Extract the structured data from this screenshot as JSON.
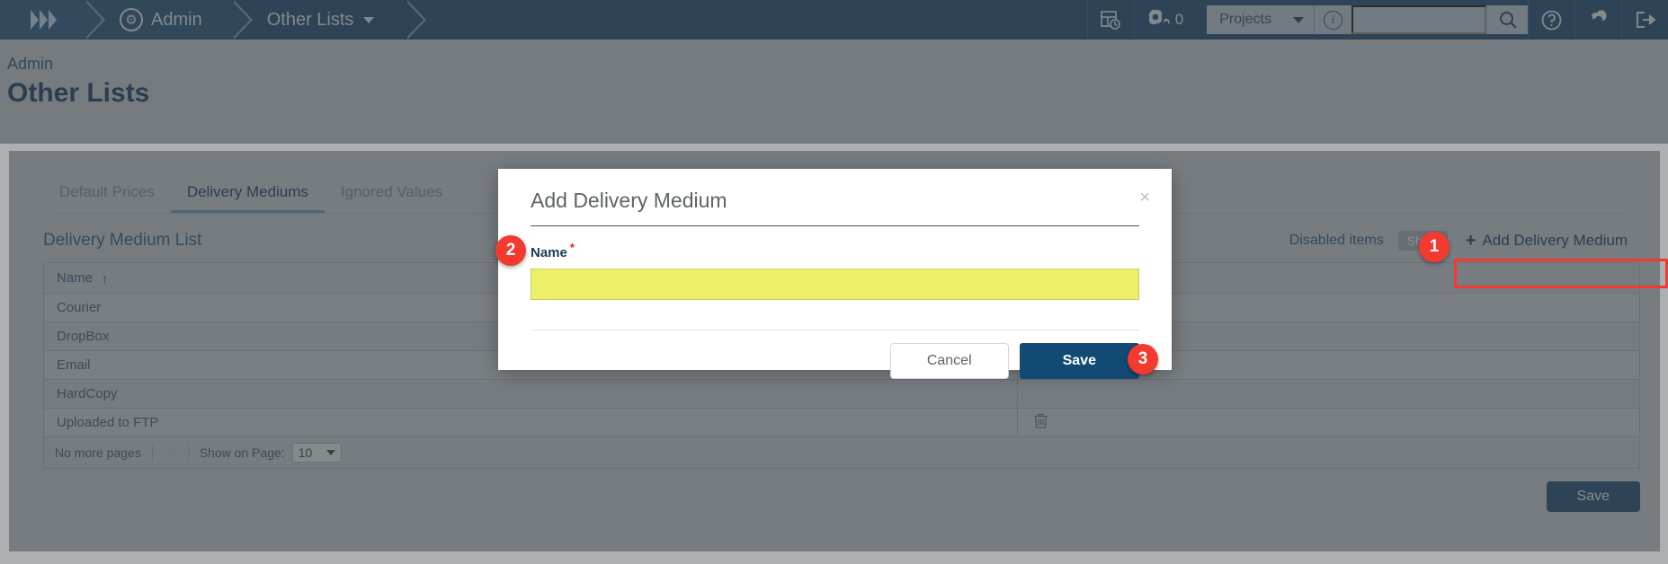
{
  "topbar": {
    "menu_icon": "hamburger-icon",
    "breadcrumbs": [
      {
        "label": "Admin",
        "icon": "gear-icon"
      },
      {
        "label": "Other Lists",
        "icon": "chevron-down-icon"
      }
    ],
    "dashboard_icon": "dashboard-clock-icon",
    "gears_icon": "gears-icon",
    "gears_count": "0",
    "project_select": "Projects",
    "info_icon": "info-icon",
    "search_placeholder": "",
    "search_icon": "search-icon",
    "help_icon": "help-icon",
    "settings_icon": "gear-icon",
    "logout_icon": "logout-icon"
  },
  "pagehead": {
    "parent": "Admin",
    "title": "Other Lists"
  },
  "tabs": [
    {
      "label": "Default Prices",
      "active": false
    },
    {
      "label": "Delivery Mediums",
      "active": true
    },
    {
      "label": "Ignored Values",
      "active": false
    }
  ],
  "list": {
    "title": "Delivery Medium List",
    "disabled_items_label": "Disabled items",
    "show_toggle": "Show",
    "add_button": "Add Delivery Medium",
    "add_plus": "+",
    "column_header": "Name",
    "sort_arrow": "↑",
    "rows": [
      {
        "name": "Courier",
        "action": ""
      },
      {
        "name": "DropBox",
        "action": ""
      },
      {
        "name": "Email",
        "action": ""
      },
      {
        "name": "HardCopy",
        "action": ""
      },
      {
        "name": "Uploaded to FTP",
        "action": "trash-icon"
      }
    ],
    "pager": {
      "status": "No more pages",
      "refresh_icon": "spinner-icon",
      "show_on_page_label": "Show on Page:",
      "page_size": "10"
    },
    "save_button": "Save"
  },
  "modal": {
    "title": "Add Delivery Medium",
    "close_icon": "×",
    "field_label": "Name",
    "required_mark": "*",
    "field_value": "",
    "field_placeholder": "",
    "cancel_button": "Cancel",
    "save_button": "Save"
  },
  "annotations": {
    "markers": [
      {
        "id": "1",
        "target": "add-delivery-medium-button"
      },
      {
        "id": "2",
        "target": "name-field"
      },
      {
        "id": "3",
        "target": "modal-save-button"
      }
    ],
    "highlight_color": "#f4392f"
  }
}
